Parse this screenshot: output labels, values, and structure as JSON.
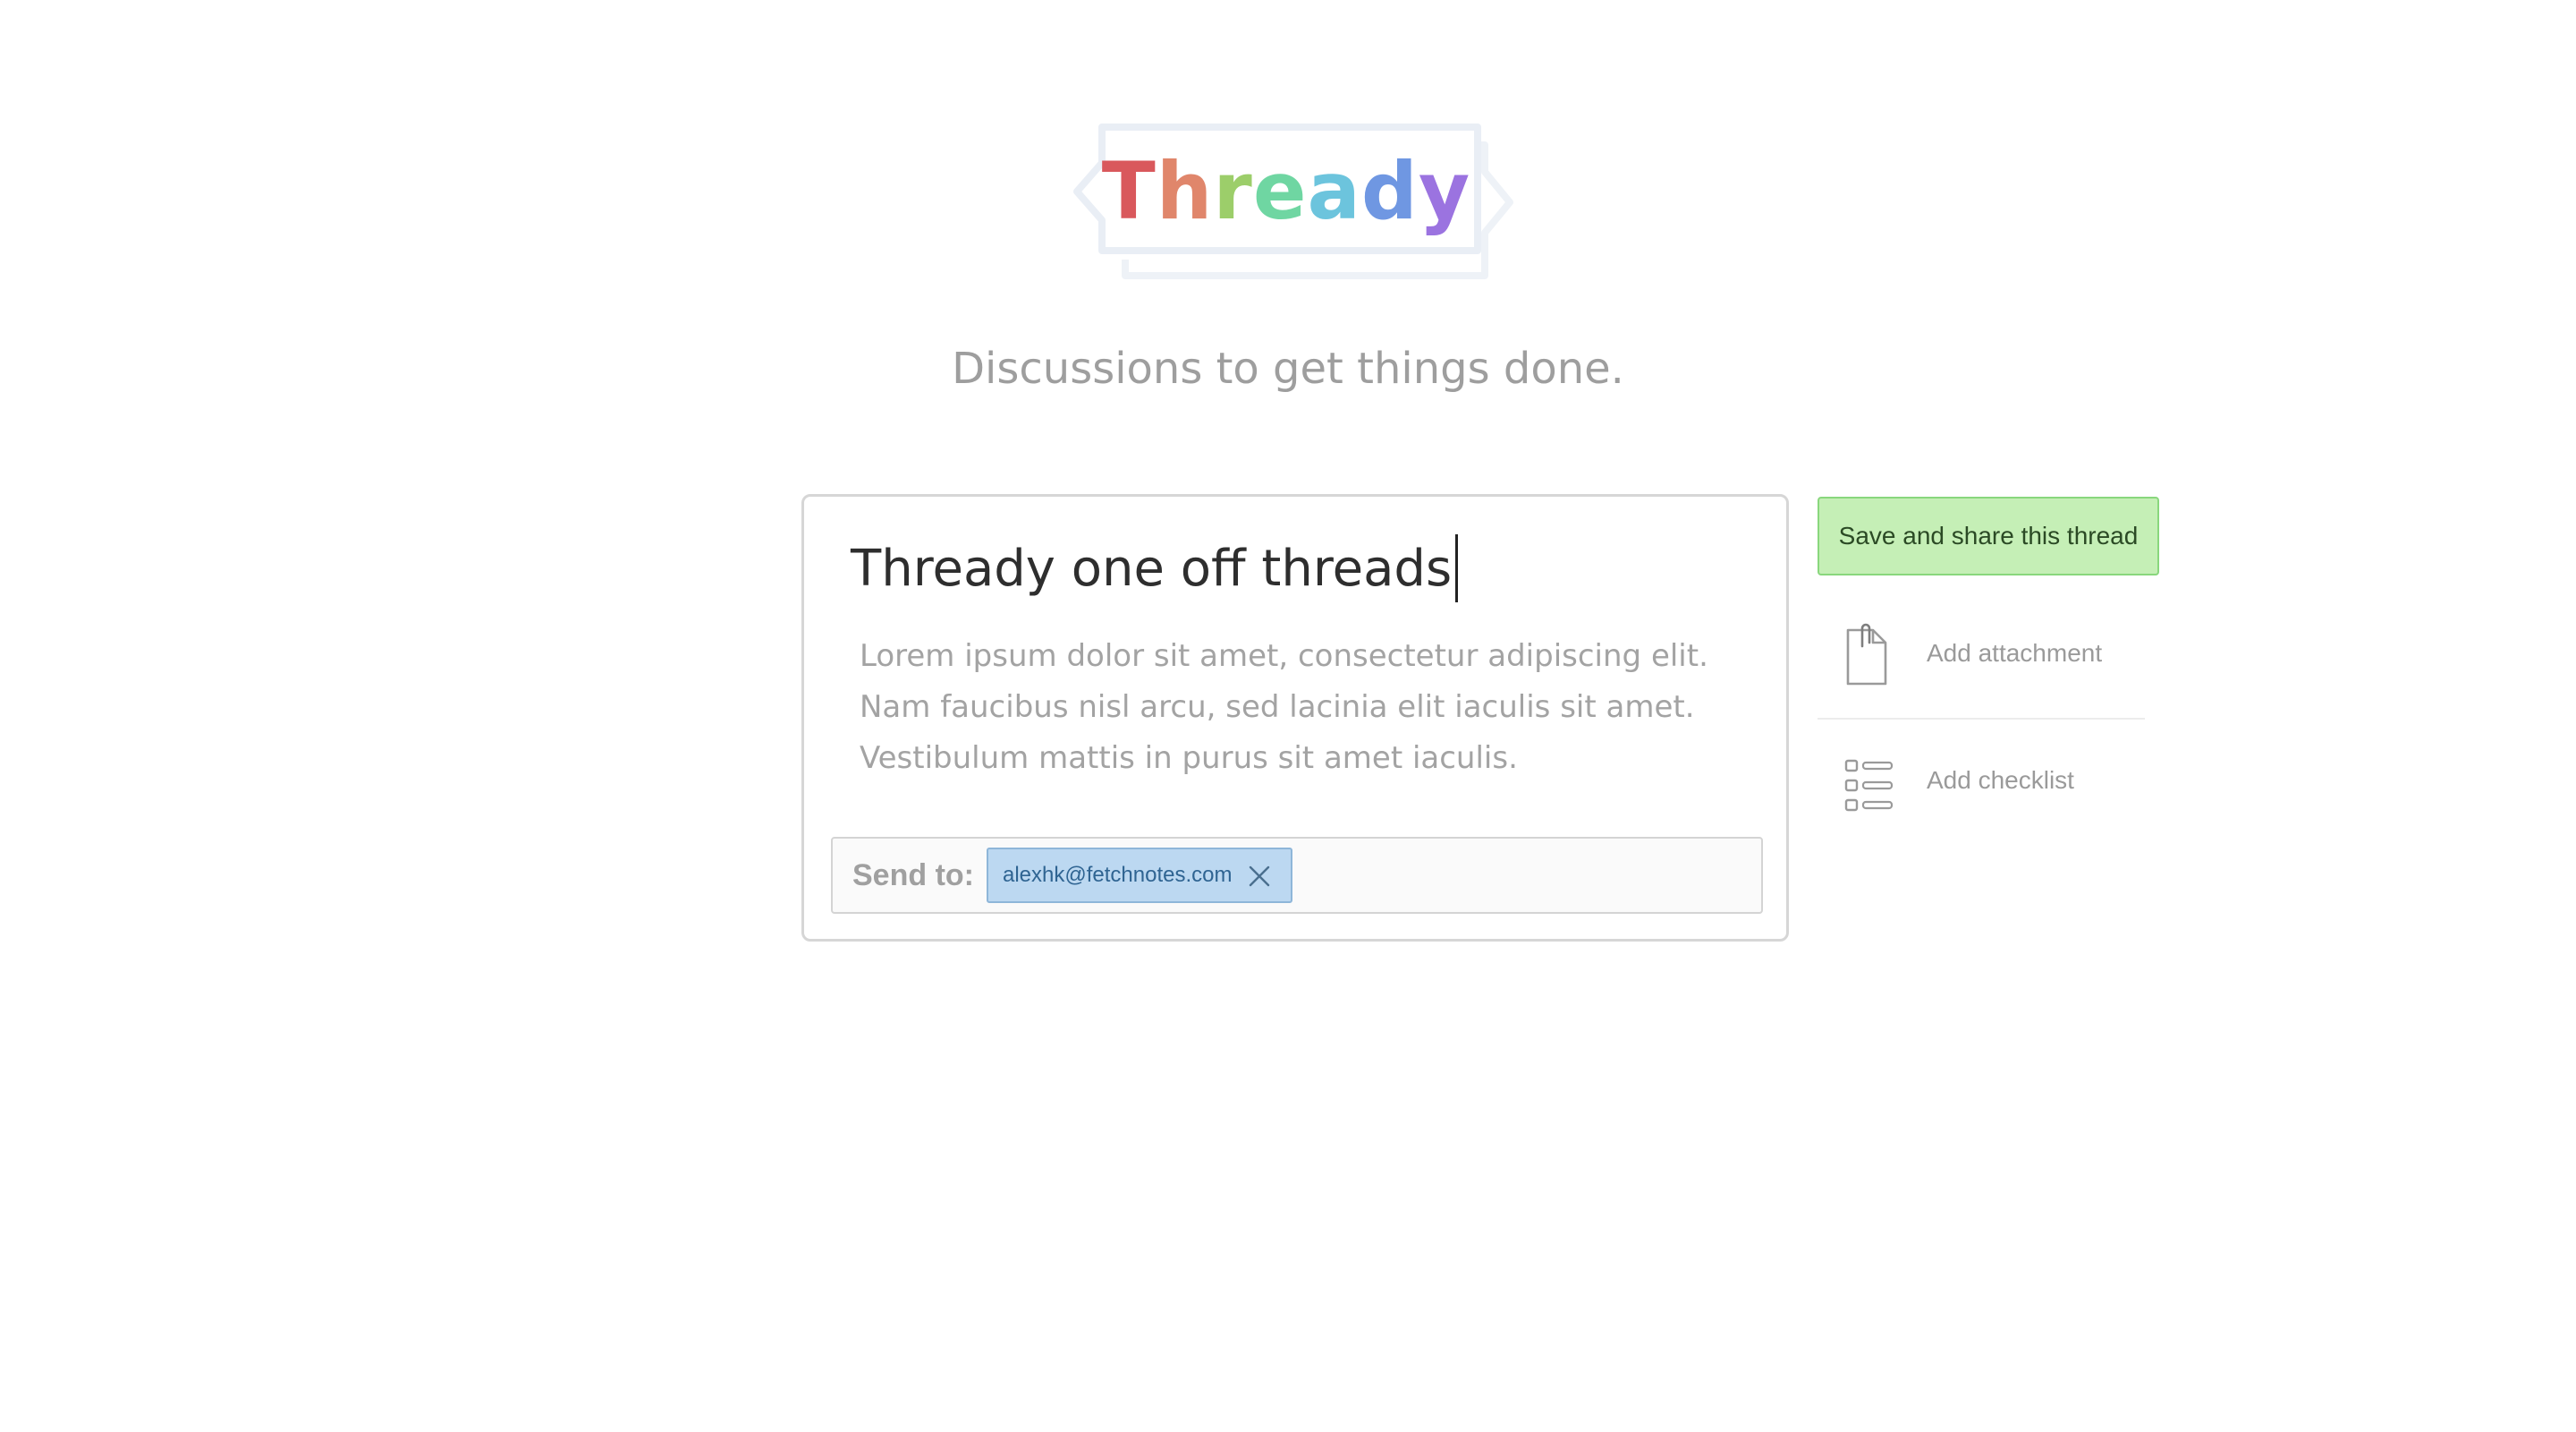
{
  "app": {
    "logo_letters": [
      {
        "char": "T",
        "color": "#d9585c"
      },
      {
        "char": "h",
        "color": "#e0866b"
      },
      {
        "char": "r",
        "color": "#9cce6a"
      },
      {
        "char": "e",
        "color": "#6fd6a2"
      },
      {
        "char": "a",
        "color": "#6cc4dd"
      },
      {
        "char": "d",
        "color": "#6f97e2"
      },
      {
        "char": "y",
        "color": "#9b73e0"
      }
    ],
    "tagline": "Discussions to get things done."
  },
  "composer": {
    "title": "Thready one off threads",
    "body": "Lorem ipsum dolor sit amet, consectetur adipiscing elit. Nam faucibus nisl arcu, sed lacinia elit iaculis sit amet. Vestibulum mattis in purus sit amet iaculis.",
    "send_to_label": "Send to:",
    "recipients": [
      {
        "email": "alexhk@fetchnotes.com"
      }
    ]
  },
  "actions": {
    "save_label": "Save and share this thread",
    "attachment_label": "Add attachment",
    "checklist_label": "Add checklist"
  },
  "colors": {
    "save_button_bg": "#c5efb6",
    "save_button_border": "#89d77d",
    "chip_bg": "#bcd8f1",
    "chip_border": "#8eb6d9"
  }
}
